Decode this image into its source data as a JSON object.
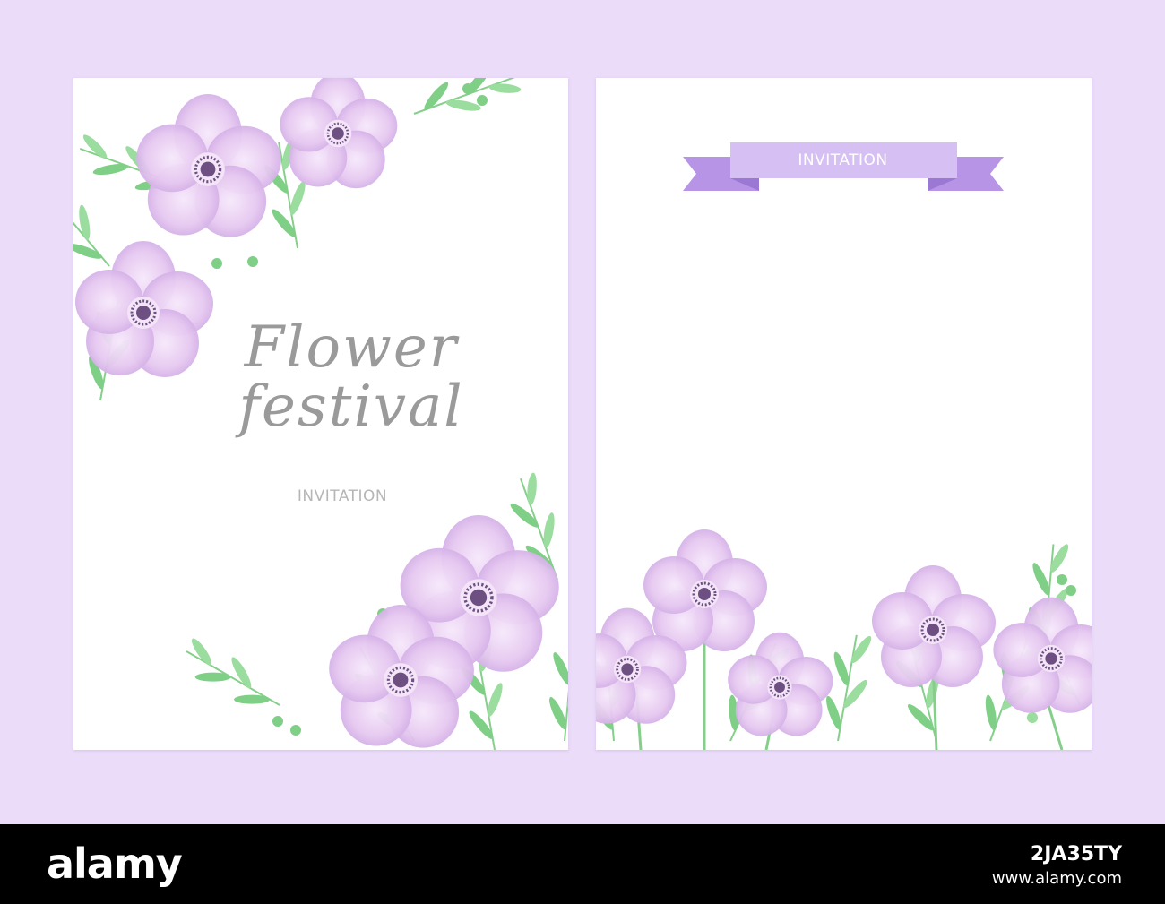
{
  "front_card": {
    "title_line1": "Flower",
    "title_line2": "festival",
    "subtitle": "INVITATION"
  },
  "back_card": {
    "ribbon_label": "INVITATION"
  },
  "watermark": {
    "logo": "alamy",
    "image_id": "2JA35TY",
    "url": "www.alamy.com"
  },
  "colors": {
    "background": "#ebdcf9",
    "petal": "#e2c3ee",
    "flower_center": "#6e4f82",
    "leaf": "#7fcf87",
    "ribbon": "#d6bff2",
    "title_text": "#9a9a9a"
  }
}
